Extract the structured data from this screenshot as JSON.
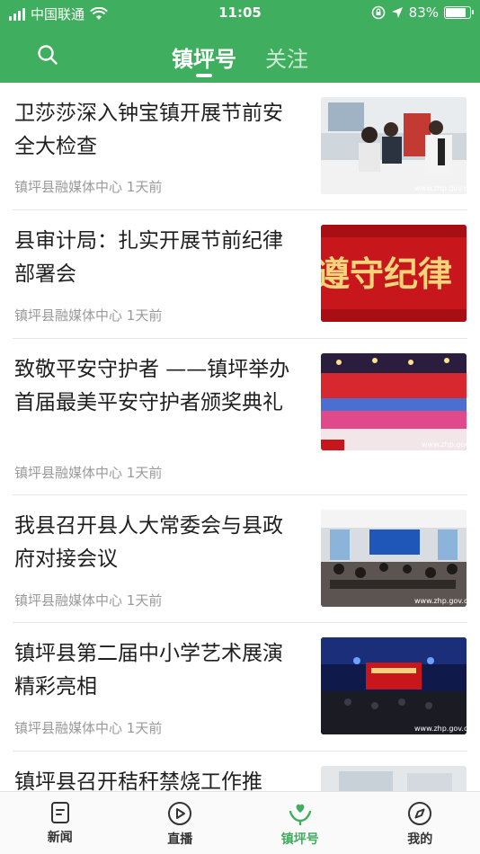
{
  "status_bar": {
    "carrier": "中国联通",
    "time": "11:05",
    "battery": "83%",
    "battery_level": 0.83
  },
  "header": {
    "tabs": [
      {
        "label": "镇坪号",
        "active": true
      },
      {
        "label": "关注",
        "active": false
      }
    ],
    "accent_color": "#3fae5e"
  },
  "news": [
    {
      "title": "卫莎莎深入钟宝镇开展节前安全大检查",
      "source": "镇坪县融媒体中心",
      "time": "1天前",
      "thumb": "meeting-photo",
      "watermark": "www.zhp.gov.cn"
    },
    {
      "title": "县审计局：扎实开展节前纪律部署会",
      "source": "镇坪县融媒体中心",
      "time": "1天前",
      "thumb": "red-banner",
      "banner_text": "遵守纪律"
    },
    {
      "title": "致敬平安守护者 ——镇坪举办首届最美平安守护者颁奖典礼",
      "source": "镇坪县融媒体中心",
      "time": "1天前",
      "thumb": "ceremony-stage",
      "watermark": "www.zhp.gov.cn"
    },
    {
      "title": "我县召开县人大常委会与县政府对接会议",
      "source": "镇坪县融媒体中心",
      "time": "1天前",
      "thumb": "conference-room",
      "watermark": "www.zhp.gov.cn"
    },
    {
      "title": "镇坪县第二届中小学艺术展演精彩亮相",
      "source": "镇坪县融媒体中心",
      "time": "1天前",
      "thumb": "stage-performance",
      "watermark": "www.zhp.gov.cn"
    },
    {
      "title": "镇坪县召开秸秆禁烧工作推",
      "source": "",
      "time": "",
      "thumb": "partial-photo"
    }
  ],
  "bottom_nav": [
    {
      "label": "新闻",
      "icon": "news-icon",
      "active": false
    },
    {
      "label": "直播",
      "icon": "play-icon",
      "active": false
    },
    {
      "label": "镇坪号",
      "icon": "heart-hands-icon",
      "active": true
    },
    {
      "label": "我的",
      "icon": "compass-icon",
      "active": false
    }
  ]
}
